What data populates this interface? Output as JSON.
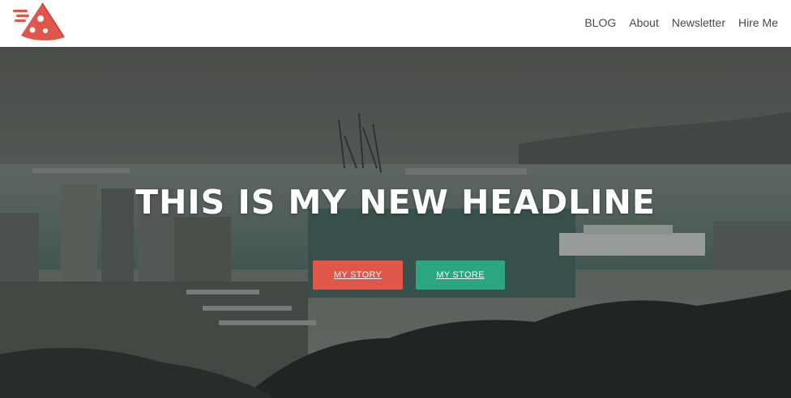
{
  "header": {
    "logo_icon": "pizza-slice-icon",
    "nav": [
      {
        "label": "BLOG"
      },
      {
        "label": "About"
      },
      {
        "label": "Newsletter"
      },
      {
        "label": "Hire Me"
      }
    ]
  },
  "hero": {
    "background": "harbor-city-photo",
    "headline": "THIS IS MY NEW HEADLINE",
    "buttons": {
      "story": {
        "label": "MY STORY"
      },
      "store": {
        "label": "MY STORE"
      }
    }
  },
  "colors": {
    "brand_red": "#e0564a",
    "accent_green": "#2aa680",
    "nav_text": "#4a4a4a"
  }
}
